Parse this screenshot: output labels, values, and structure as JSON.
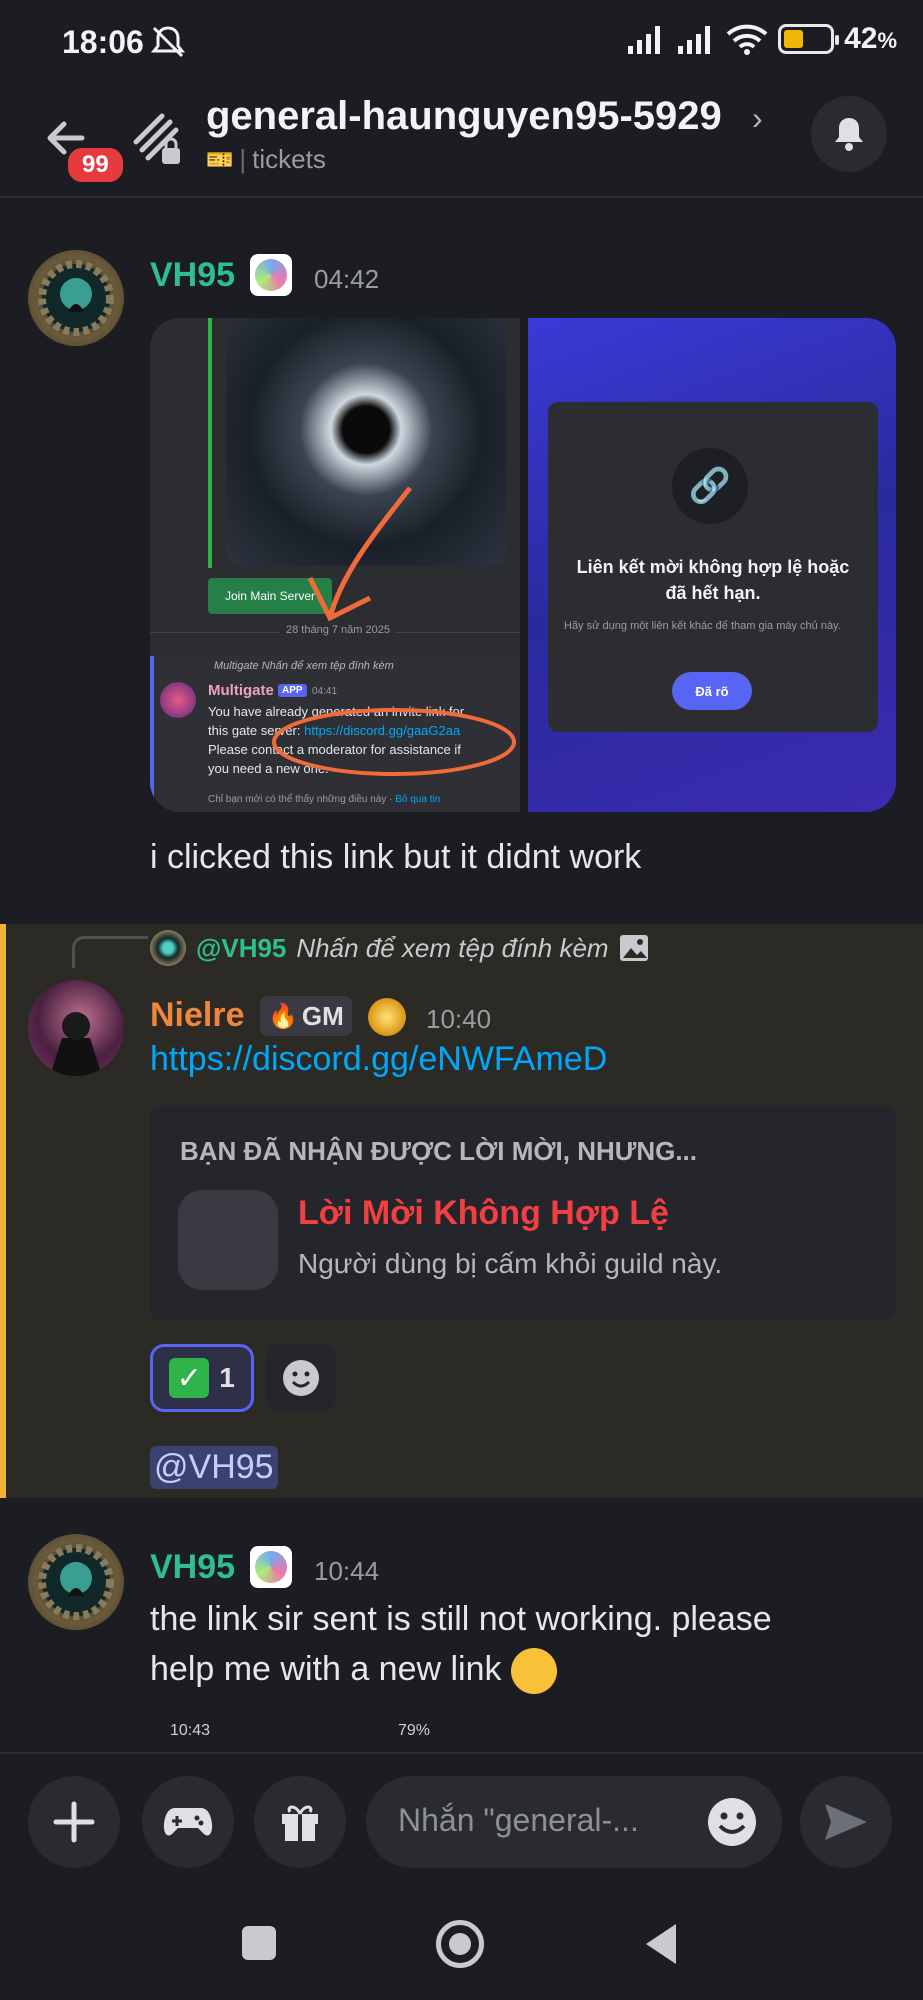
{
  "status_bar": {
    "time": "18:06",
    "battery": "42",
    "battery_pct_suffix": "%"
  },
  "header": {
    "unread_badge": "99",
    "channel_name": "general-haunguyen95-5929",
    "category": "tickets"
  },
  "messages": [
    {
      "author": "VH95",
      "author_color": "#2fbf8f",
      "time": "04:42",
      "attachment_left": {
        "button": "Join Main Server",
        "date_divider": "28 tháng 7 năm 2025",
        "bot_ref": "Multigate Nhấn để xem tệp đính kèm",
        "bot_name": "Multigate",
        "bot_tag": "APP",
        "bot_time": "04:41",
        "bot_line1": "You have already generated an invite link for",
        "bot_line2_pre": "this gate server: ",
        "bot_link": "https://discord.gg/gaaG2aa",
        "bot_line3": "Please contact a moderator for assistance if",
        "bot_line4": "you need a new one.",
        "bot_footer": "Chỉ bạn mới có thể thấy những điều này · ",
        "bot_dismiss": "Bỏ qua tin"
      },
      "attachment_right": {
        "title": "Liên kết mời không hợp lệ hoặc đã hết hạn.",
        "subtitle": "Hãy sử dụng một liên kết khác để tham gia máy chủ này.",
        "button": "Đã rõ"
      },
      "text": "i clicked this link but it didnt work"
    },
    {
      "reply_to_author": "@VH95",
      "reply_to_text": "Nhấn để xem tệp đính kèm",
      "author": "Nielre",
      "author_color": "#f0863d",
      "role_tag": "GM",
      "time": "10:40",
      "link": "https://discord.gg/eNWFAmeD",
      "invite_embed": {
        "heading": "BẠN ĐÃ NHẬN ĐƯỢC LỜI MỜI, NHƯNG...",
        "title": "Lời Mời Không Hợp Lệ",
        "subtitle": "Người dùng bị cấm khỏi guild này."
      },
      "reaction_count": "1",
      "mention": "@VH95"
    },
    {
      "author": "VH95",
      "author_color": "#2fbf8f",
      "time": "10:44",
      "text_line1": "the link sir sent is still not working. please",
      "text_line2": "help me with a new link",
      "preview_time": "10:43",
      "preview_battery": "79"
    }
  ],
  "composer": {
    "placeholder": "Nhắn \"general-..."
  },
  "icons": [
    "back-arrow-icon",
    "threads-icon",
    "bell-icon",
    "plus-icon",
    "gamepad-icon",
    "gift-icon",
    "emoji-icon",
    "send-icon"
  ]
}
